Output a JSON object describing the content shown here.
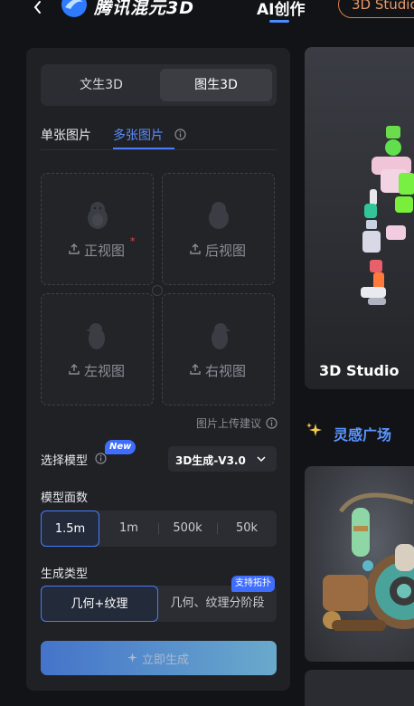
{
  "header": {
    "logo_text": "腾讯混元3D",
    "nav_ai": "AI创作",
    "nav_studio": "3D Studio"
  },
  "mode_tabs": [
    "文生3D",
    "图生3D"
  ],
  "image_tabs": {
    "single": "单张图片",
    "multi": "多张图片"
  },
  "views": [
    {
      "label": "正视图",
      "required": "*"
    },
    {
      "label": "后视图"
    },
    {
      "label": "左视图"
    },
    {
      "label": "右视图"
    }
  ],
  "upload_tip": "图片上传建议",
  "model": {
    "label": "选择模型",
    "badge": "New",
    "value": "3D生成-V3.0"
  },
  "faces": {
    "label": "模型面数",
    "options": [
      "1.5m",
      "1m",
      "500k",
      "50k"
    ],
    "selected": "1.5m"
  },
  "generation": {
    "label": "生成类型",
    "options": [
      "几何+纹理",
      "几何、纹理分阶段"
    ],
    "selected": "几何+纹理",
    "badge": "支持拓扑"
  },
  "generate_button": "立即生成",
  "studio_card": {
    "title": "3D Studio"
  },
  "inspiration": {
    "title": "灵感广场"
  },
  "colors": {
    "accent": "#4a7bff",
    "panel": "#1f2125",
    "studio_border": "#d87b4a"
  }
}
